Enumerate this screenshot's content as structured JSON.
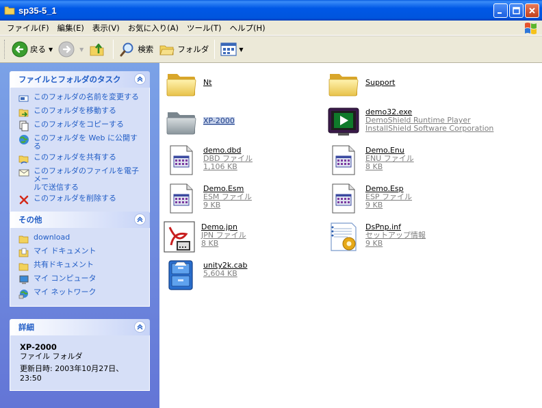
{
  "window": {
    "title": "sp35-5_1"
  },
  "menu": [
    "ファイル(F)",
    "編集(E)",
    "表示(V)",
    "お気に入り(A)",
    "ツール(T)",
    "ヘルプ(H)"
  ],
  "toolbar": {
    "back": "戻る",
    "search": "検索",
    "folders": "フォルダ"
  },
  "tasks": {
    "title": "ファイルとフォルダのタスク",
    "items": [
      "このフォルダの名前を変更する",
      "このフォルダを移動する",
      "このフォルダをコピーする",
      "このフォルダを Web に公開する",
      "このフォルダを共有する",
      "このフォルダのファイルを電子メー",
      "ルで送信する",
      "このフォルダを削除する"
    ]
  },
  "other": {
    "title": "その他",
    "items": [
      "download",
      "マイ ドキュメント",
      "共有ドキュメント",
      "マイ コンピュータ",
      "マイ ネットワーク"
    ]
  },
  "details": {
    "title": "詳細",
    "name": "XP-2000",
    "type": "ファイル フォルダ",
    "modified": "更新日時: 2003年10月27日、23:50"
  },
  "files": [
    {
      "name": "Nt",
      "line2": "",
      "line3": ""
    },
    {
      "name": "Support",
      "line2": "",
      "line3": ""
    },
    {
      "name": "XP-2000",
      "line2": "",
      "line3": ""
    },
    {
      "name": "demo32.exe",
      "line2": "DemoShield Runtime Player",
      "line3": "InstallShield Software Corporation"
    },
    {
      "name": "demo.dbd",
      "line2": "DBD ファイル",
      "line3": "1,106 KB"
    },
    {
      "name": "Demo.Enu",
      "line2": "ENU ファイル",
      "line3": "8 KB"
    },
    {
      "name": "Demo.Esm",
      "line2": "ESM ファイル",
      "line3": "9 KB"
    },
    {
      "name": "Demo.Esp",
      "line2": "ESP ファイル",
      "line3": "9 KB"
    },
    {
      "name": "Demo.jpn",
      "line2": "JPN ファイル",
      "line3": "8 KB"
    },
    {
      "name": "DsPnp.inf",
      "line2": "セットアップ情報",
      "line3": "9 KB"
    },
    {
      "name": "unity2k.cab",
      "line2": "5,604 KB",
      "line3": ""
    }
  ]
}
